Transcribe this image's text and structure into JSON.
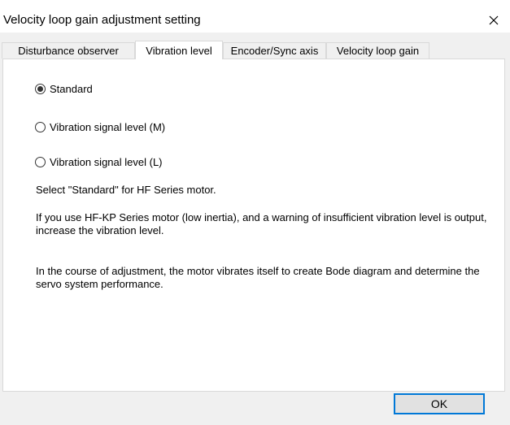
{
  "window": {
    "title": "Velocity loop gain adjustment setting",
    "close_icon": "close-icon"
  },
  "tabs": [
    {
      "label": "Disturbance observer",
      "active": false
    },
    {
      "label": "Vibration level",
      "active": true
    },
    {
      "label": "Encoder/Sync axis",
      "active": false
    },
    {
      "label": "Velocity loop gain",
      "active": false
    }
  ],
  "options": [
    {
      "label": "Standard",
      "selected": true
    },
    {
      "label": "Vibration signal level (M)",
      "selected": false
    },
    {
      "label": "Vibration signal level (L)",
      "selected": false
    }
  ],
  "notes": {
    "note1": "Select \"Standard\" for HF Series motor.",
    "note2": "If you use HF-KP Series motor (low inertia), and a warning of insufficient vibration level is output, increase the vibration level.",
    "note3": "In the course of adjustment, the motor vibrates itself to create Bode diagram and determine the servo system performance."
  },
  "buttons": {
    "ok_label": "OK"
  }
}
